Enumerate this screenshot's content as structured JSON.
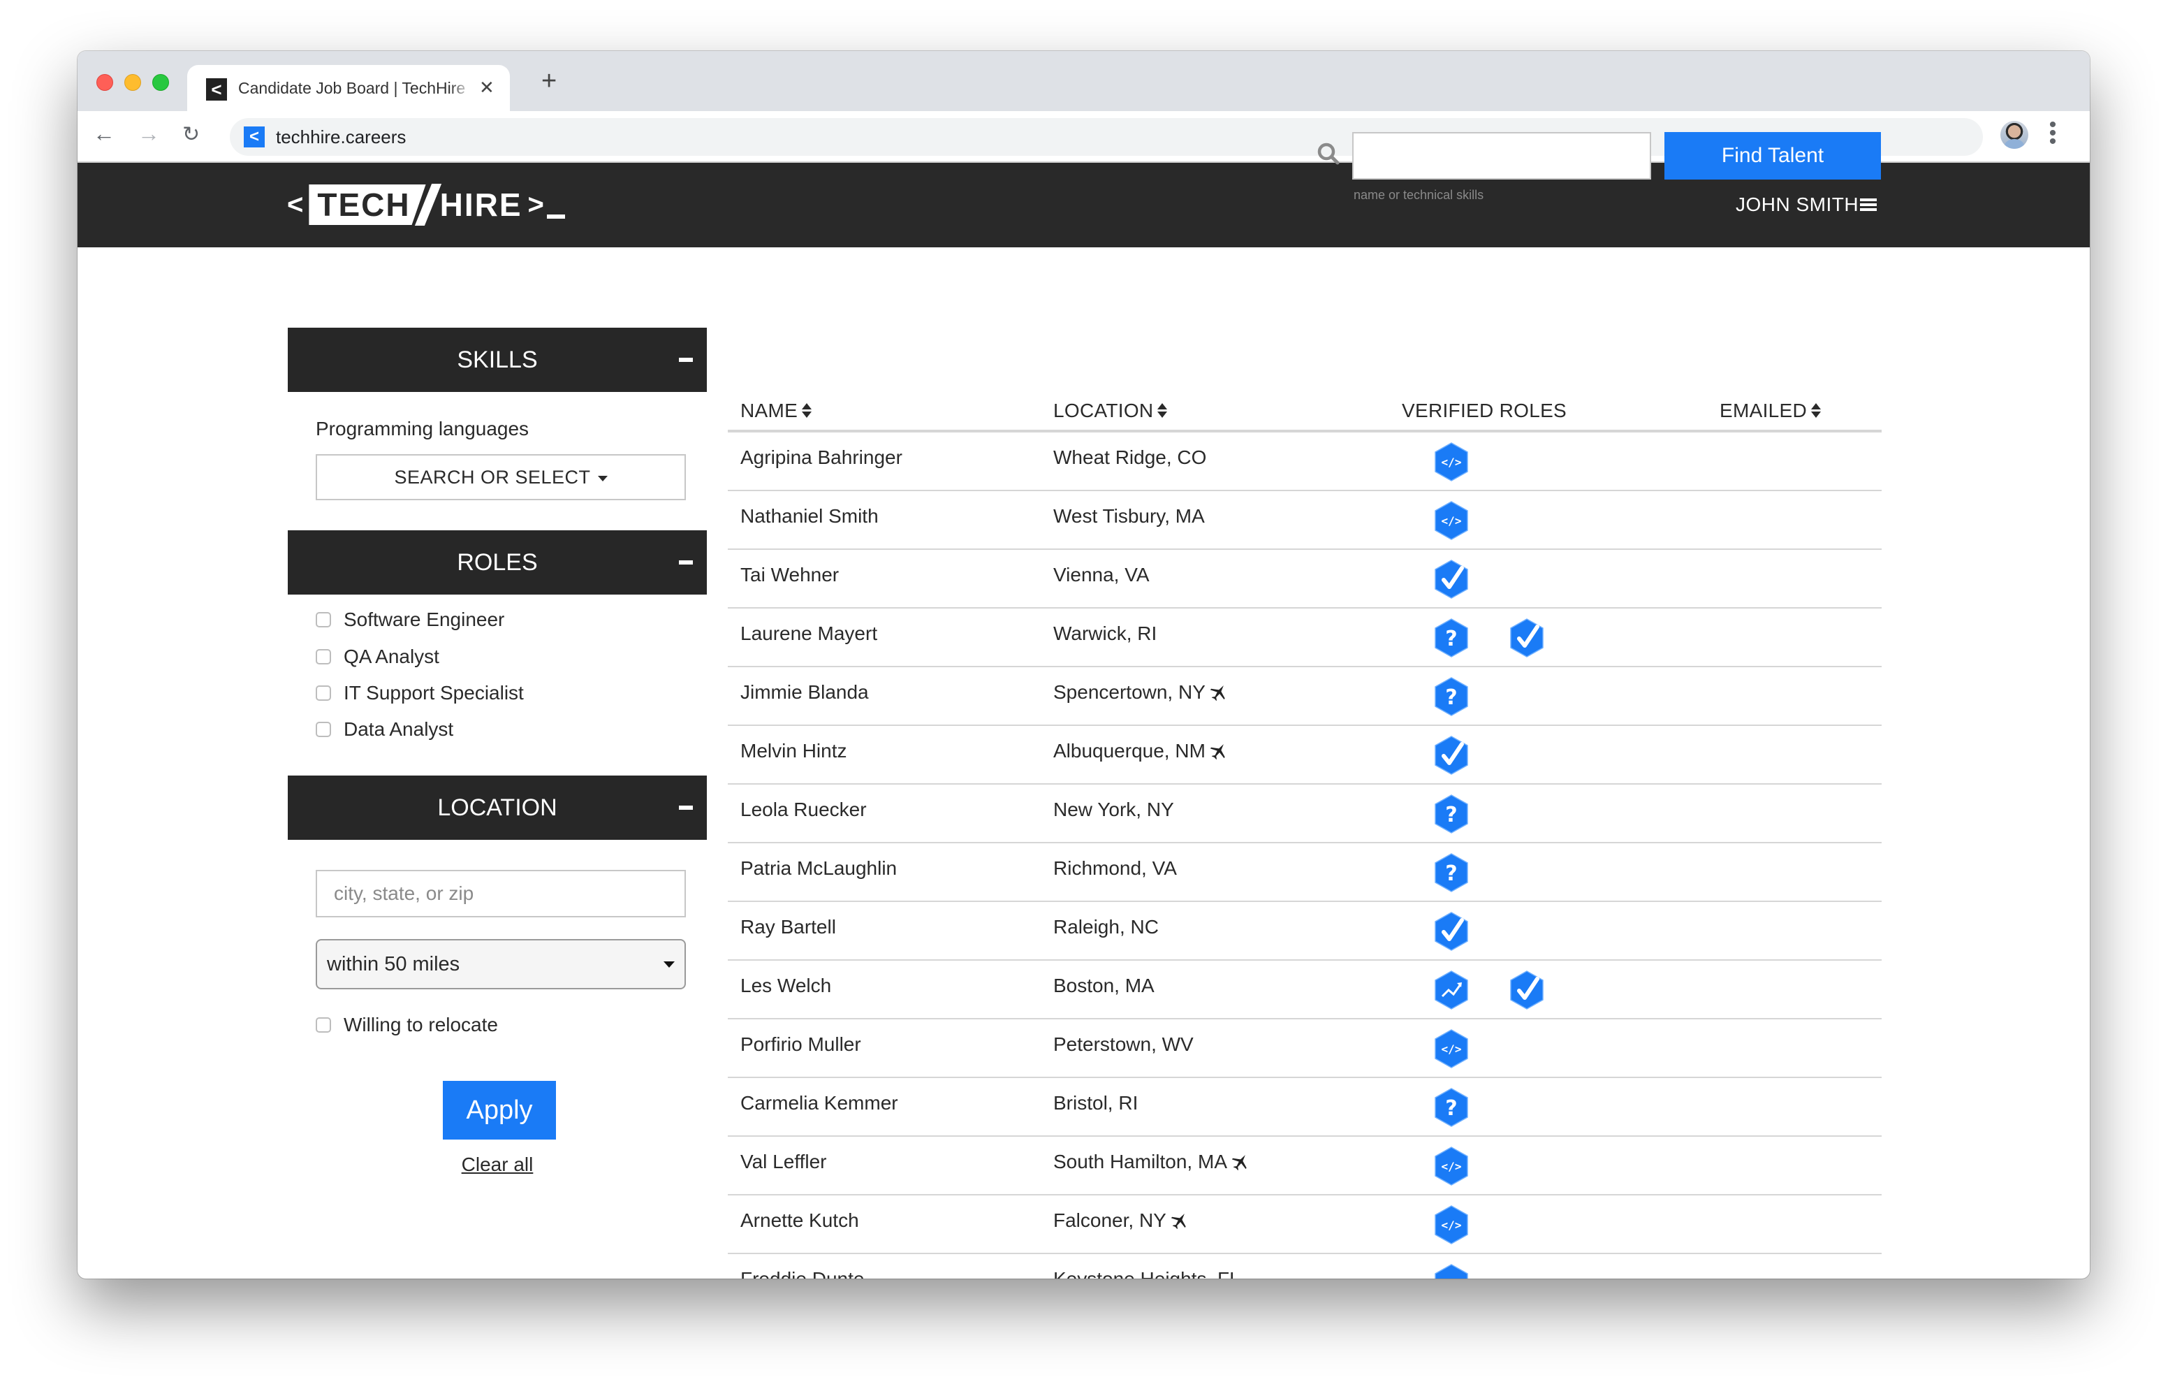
{
  "browser": {
    "tab_title": "Candidate Job Board | TechHire",
    "tab_favicon_glyph": "<",
    "tab_close_glyph": "✕",
    "new_tab_glyph": "+",
    "url": "techhire.careers",
    "site_icon_glyph": "<",
    "nav": {
      "back_glyph": "←",
      "forward_glyph": "→",
      "reload_glyph": "↻",
      "menu_glyph": "⋮"
    }
  },
  "header": {
    "logo": {
      "left": "<",
      "tech": "TECH",
      "hire": "HIRE",
      "right": ">"
    },
    "user_name": "JOHN SMITH"
  },
  "colors": {
    "accent": "#1a7bf6",
    "header_bg": "#292929",
    "section_bg": "#272727"
  },
  "sidebar": {
    "skills": {
      "title": "SKILLS",
      "programming_label": "Programming languages",
      "select_label": "SEARCH OR SELECT"
    },
    "roles": {
      "title": "ROLES",
      "options": [
        {
          "label": "Software Engineer",
          "checked": false
        },
        {
          "label": "QA Analyst",
          "checked": false
        },
        {
          "label": "IT Support Specialist",
          "checked": false
        },
        {
          "label": "Data Analyst",
          "checked": false
        }
      ]
    },
    "location": {
      "title": "LOCATION",
      "input_placeholder": "city, state, or zip",
      "input_value": "",
      "radius_selected": "within 50 miles",
      "relocate_label": "Willing to relocate",
      "relocate_checked": false
    },
    "apply_label": "Apply",
    "clear_label": "Clear all"
  },
  "search": {
    "value": "",
    "help_text": "name or technical skills",
    "button_label": "Find Talent"
  },
  "table": {
    "columns": [
      {
        "label": "NAME",
        "sortable": true
      },
      {
        "label": "LOCATION",
        "sortable": true
      },
      {
        "label": "VERIFIED ROLES",
        "sortable": false
      },
      {
        "label": "EMAILED",
        "sortable": true
      }
    ],
    "rows": [
      {
        "name": "Agripina Bahringer",
        "location": "Wheat Ridge, CO",
        "relocate": false,
        "roles": [
          "code"
        ]
      },
      {
        "name": "Nathaniel Smith",
        "location": "West Tisbury, MA",
        "relocate": false,
        "roles": [
          "code"
        ]
      },
      {
        "name": "Tai Wehner",
        "location": "Vienna, VA",
        "relocate": false,
        "roles": [
          "check"
        ]
      },
      {
        "name": "Laurene Mayert",
        "location": "Warwick, RI",
        "relocate": false,
        "roles": [
          "question",
          "check"
        ]
      },
      {
        "name": "Jimmie Blanda",
        "location": "Spencertown, NY",
        "relocate": true,
        "roles": [
          "question"
        ]
      },
      {
        "name": "Melvin Hintz",
        "location": "Albuquerque, NM",
        "relocate": true,
        "roles": [
          "check"
        ]
      },
      {
        "name": "Leola Ruecker",
        "location": "New York, NY",
        "relocate": false,
        "roles": [
          "question"
        ]
      },
      {
        "name": "Patria McLaughlin",
        "location": "Richmond, VA",
        "relocate": false,
        "roles": [
          "question"
        ]
      },
      {
        "name": "Ray Bartell",
        "location": "Raleigh, NC",
        "relocate": false,
        "roles": [
          "check"
        ]
      },
      {
        "name": "Les Welch",
        "location": "Boston, MA",
        "relocate": false,
        "roles": [
          "chart",
          "check"
        ]
      },
      {
        "name": "Porfirio Muller",
        "location": "Peterstown, WV",
        "relocate": false,
        "roles": [
          "code"
        ]
      },
      {
        "name": "Carmelia Kemmer",
        "location": "Bristol, RI",
        "relocate": false,
        "roles": [
          "question"
        ]
      },
      {
        "name": "Val Leffler",
        "location": "South Hamilton, MA",
        "relocate": true,
        "roles": [
          "code"
        ]
      },
      {
        "name": "Arnette Kutch",
        "location": "Falconer, NY",
        "relocate": true,
        "roles": [
          "code"
        ]
      },
      {
        "name": "Freddie Dunte",
        "location": "Keystone Heights, FL",
        "relocate": false,
        "roles": [
          "code"
        ]
      }
    ]
  }
}
